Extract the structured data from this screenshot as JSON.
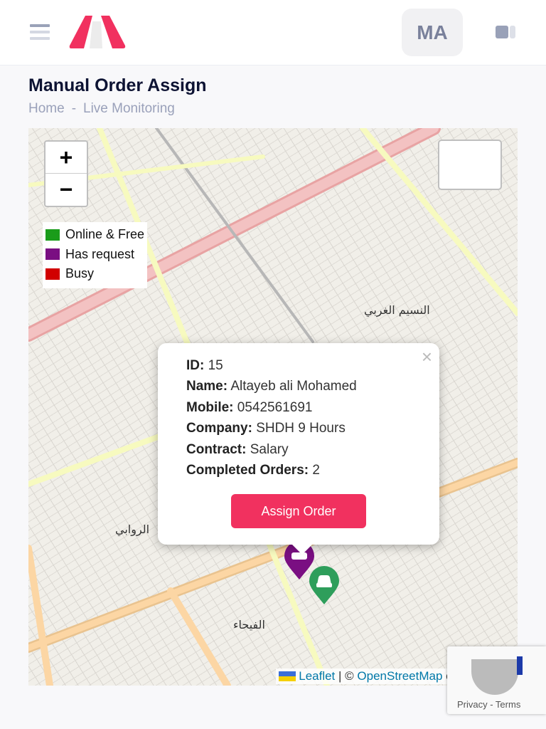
{
  "header": {
    "avatar_initials": "MA"
  },
  "page": {
    "title": "Manual Order Assign",
    "breadcrumb": [
      "Home",
      "Live Monitoring"
    ]
  },
  "map": {
    "zoom_in": "+",
    "zoom_out": "−",
    "legend": [
      {
        "label": "Online & Free",
        "color": "#1a9c1a"
      },
      {
        "label": "Has request",
        "color": "#7a0f82"
      },
      {
        "label": "Busy",
        "color": "#d10000"
      }
    ],
    "labels": [
      "النسيم الغربي",
      "الروابي",
      "الفيحاء"
    ],
    "attribution": {
      "leaflet": "Leaflet",
      "sep": "| ©",
      "osm": "OpenStreetMap",
      "contributors": "contributors"
    }
  },
  "popup": {
    "close": "×",
    "fields": [
      {
        "label": "ID:",
        "value": "15"
      },
      {
        "label": "Name:",
        "value": "Altayeb ali Mohamed"
      },
      {
        "label": "Mobile:",
        "value": "0542561691"
      },
      {
        "label": "Company:",
        "value": "SHDH 9 Hours"
      },
      {
        "label": "Contract:",
        "value": "Salary"
      },
      {
        "label": "Completed Orders:",
        "value": "2"
      }
    ],
    "button": "Assign Order"
  },
  "recaptcha": {
    "links": "Privacy - Terms"
  },
  "colors": {
    "accent": "#f1315f",
    "title": "#0d1333",
    "muted": "#9aa1ba"
  }
}
